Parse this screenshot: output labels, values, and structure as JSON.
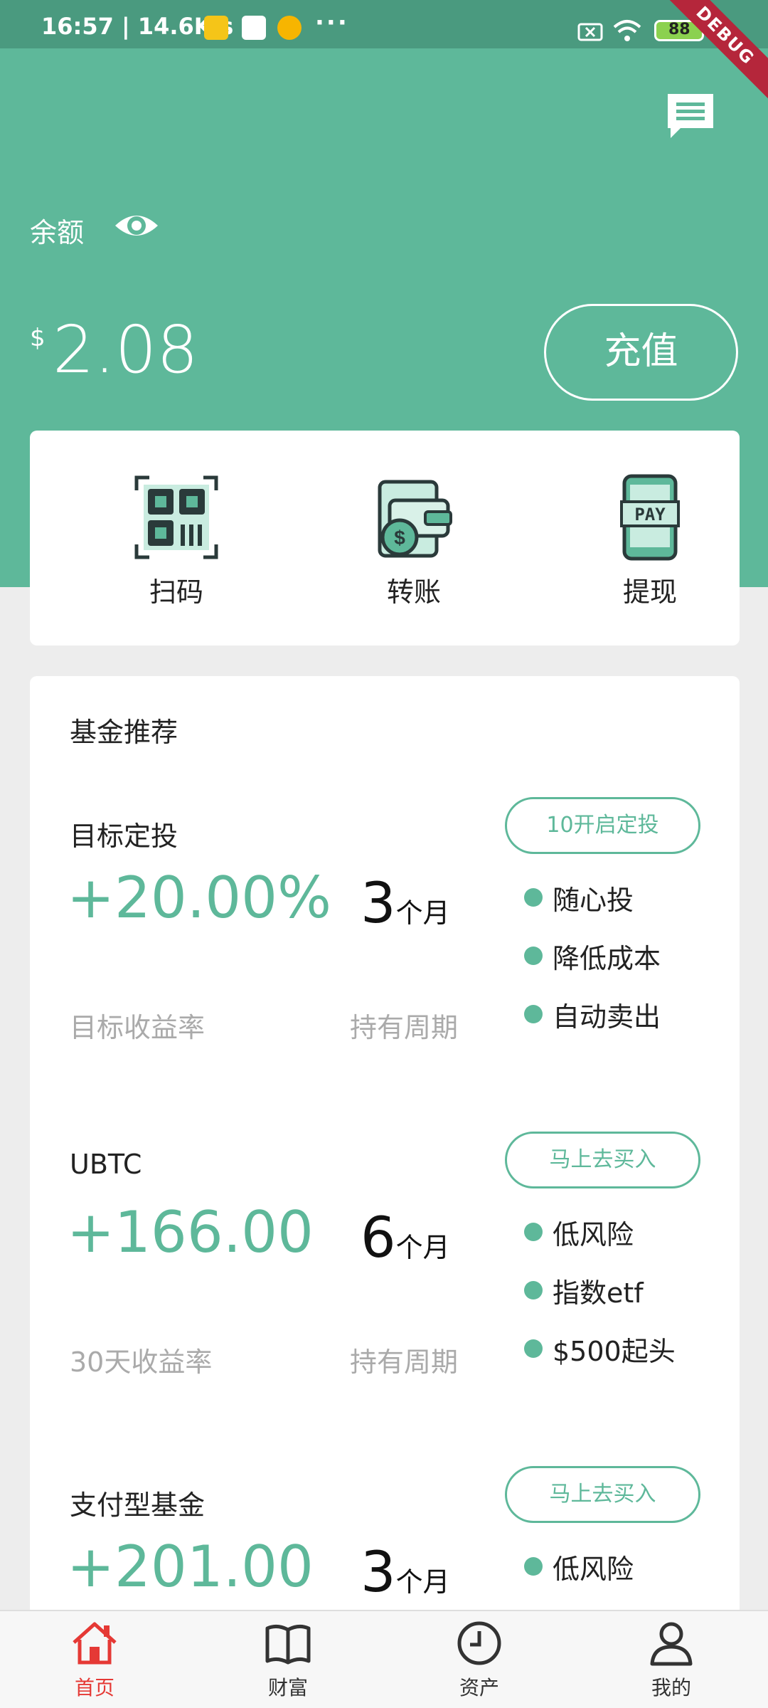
{
  "status_bar": {
    "time": "16:57 | 14.6K/s",
    "more": "···",
    "battery": "88"
  },
  "debug_label": "DEBUG",
  "balance": {
    "label": "余额",
    "currency": "$",
    "amount": "2.08",
    "recharge_label": "充值"
  },
  "quick_actions": [
    {
      "label": "扫码",
      "icon": "qr-scan-icon"
    },
    {
      "label": "转账",
      "icon": "wallet-transfer-icon"
    },
    {
      "label": "提现",
      "icon": "pay-phone-icon"
    }
  ],
  "fund_section": {
    "title": "基金推荐",
    "items": [
      {
        "name": "目标定投",
        "button": "10开启定投",
        "rate": "+20.00%",
        "period_num": "3",
        "period_unit": "个月",
        "rate_label": "目标收益率",
        "period_label": "持有周期",
        "tags": [
          "随心投",
          "降低成本",
          "自动卖出"
        ]
      },
      {
        "name": "UBTC",
        "button": "马上去买入",
        "rate": "+166.00",
        "period_num": "6",
        "period_unit": "个月",
        "rate_label": "30天收益率",
        "period_label": "持有周期",
        "tags": [
          "低风险",
          "指数etf",
          "$500起头"
        ]
      },
      {
        "name": "支付型基金",
        "button": "马上去买入",
        "rate": "+201.00",
        "period_num": "3",
        "period_unit": "个月",
        "rate_label": "",
        "period_label": "",
        "tags": [
          "低风险"
        ]
      }
    ]
  },
  "bottom_nav": [
    {
      "label": "首页",
      "icon": "home-icon",
      "active": true
    },
    {
      "label": "财富",
      "icon": "book-icon",
      "active": false
    },
    {
      "label": "资产",
      "icon": "clock-icon",
      "active": false
    },
    {
      "label": "我的",
      "icon": "user-icon",
      "active": false
    }
  ],
  "colors": {
    "primary": "#5eb89a",
    "status_bar": "#4a9a7f",
    "active_nav": "#e53935",
    "background": "#ededed"
  }
}
